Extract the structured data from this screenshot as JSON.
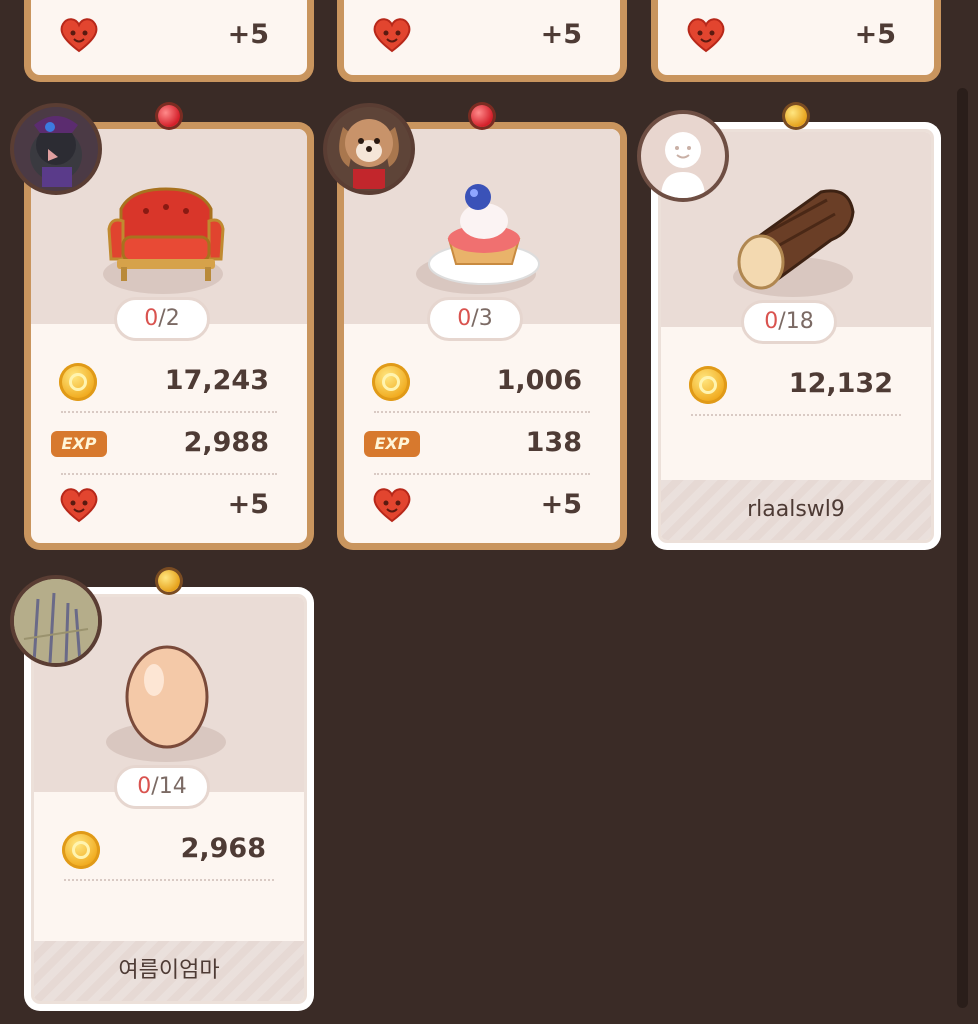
{
  "top_cards": [
    {
      "heart_value": "+5"
    },
    {
      "heart_value": "+5"
    },
    {
      "heart_value": "+5"
    }
  ],
  "cards": [
    {
      "item": "red-sofa",
      "count_current": "0",
      "count_total": "/2",
      "coins": "17,243",
      "exp_label": "EXP",
      "exp": "2,988",
      "hearts": "+5",
      "pin": "red"
    },
    {
      "item": "strawberry-tart",
      "count_current": "0",
      "count_total": "/3",
      "coins": "1,006",
      "exp_label": "EXP",
      "exp": "138",
      "hearts": "+5",
      "pin": "red"
    },
    {
      "item": "log",
      "count_current": "0",
      "count_total": "/18",
      "coins": "12,132",
      "owner": "rlaalswl9",
      "pin": "gold"
    },
    {
      "item": "egg",
      "count_current": "0",
      "count_total": "/14",
      "coins": "2,968",
      "owner": "여름이엄마",
      "pin": "gold"
    }
  ]
}
